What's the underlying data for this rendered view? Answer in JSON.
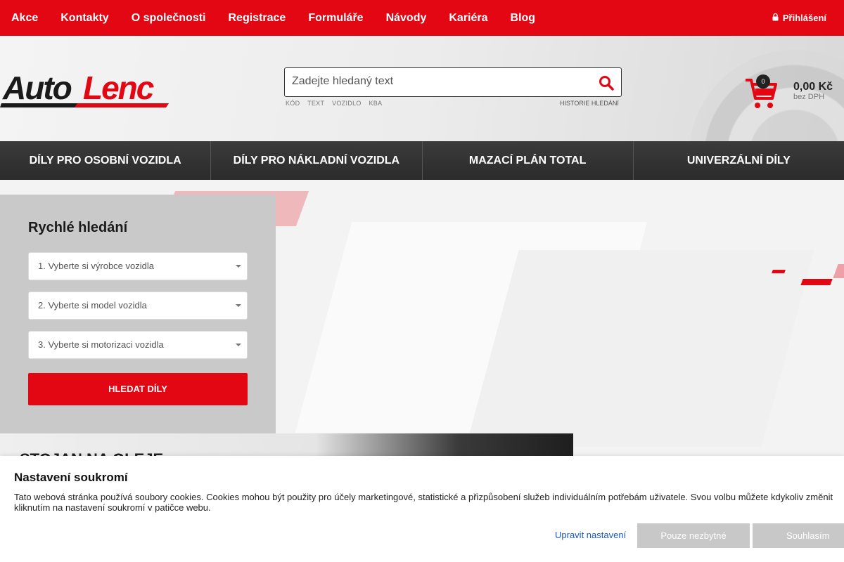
{
  "topnav": {
    "items": [
      "Akce",
      "Kontakty",
      "O společnosti",
      "Registrace",
      "Formuláře",
      "Návody",
      "Kariéra",
      "Blog"
    ],
    "login_label": "Přihlášení",
    "login_icon": "lock-icon"
  },
  "header": {
    "logo_text": "AutoLenc",
    "search": {
      "placeholder": "Zadejte hledaný text",
      "tabs": [
        "KÓD",
        "TEXT",
        "VOZIDLO",
        "KBA"
      ],
      "history_label": "HISTORIE HLEDÁNÍ"
    },
    "cart": {
      "count": "0",
      "total": "0,00 Kč",
      "vat_note": "bez DPH"
    }
  },
  "categories": [
    "DÍLY PRO OSOBNÍ VOZIDLA",
    "DÍLY PRO NÁKLADNÍ VOZIDLA",
    "MAZACÍ PLÁN TOTAL",
    "UNIVERZÁLNÍ DÍLY"
  ],
  "quick_search": {
    "title": "Rychlé hledání",
    "select_manufacturer": "1. Vyberte si výrobce vozidla",
    "select_model": "2. Vyberte si model vozidla",
    "select_engine": "3. Vyberte si motorizaci vozidla",
    "button": "HLEDAT DÍLY"
  },
  "promo": {
    "title": "STOJAN NA OLEJE"
  },
  "cookie": {
    "title": "Nastavení soukromí",
    "text_line1": "Tato webová stránka používá soubory cookies. Cookies mohou být použity pro účely marketingové, statistické a přizpůsobení služeb individuálním potřebám uživatele. Svou volbu můžete kdykoliv změnit",
    "text_line2": "kliknutím na nastavení soukromí v patičce webu.",
    "settings_link": "Upravit nastavení",
    "necessary_button": "Pouze nezbytné",
    "agree_button": "Souhlasím"
  },
  "colors": {
    "brand_red": "#e30613",
    "nav_dark": "#333333",
    "panel_gray": "#c9c9c9"
  }
}
